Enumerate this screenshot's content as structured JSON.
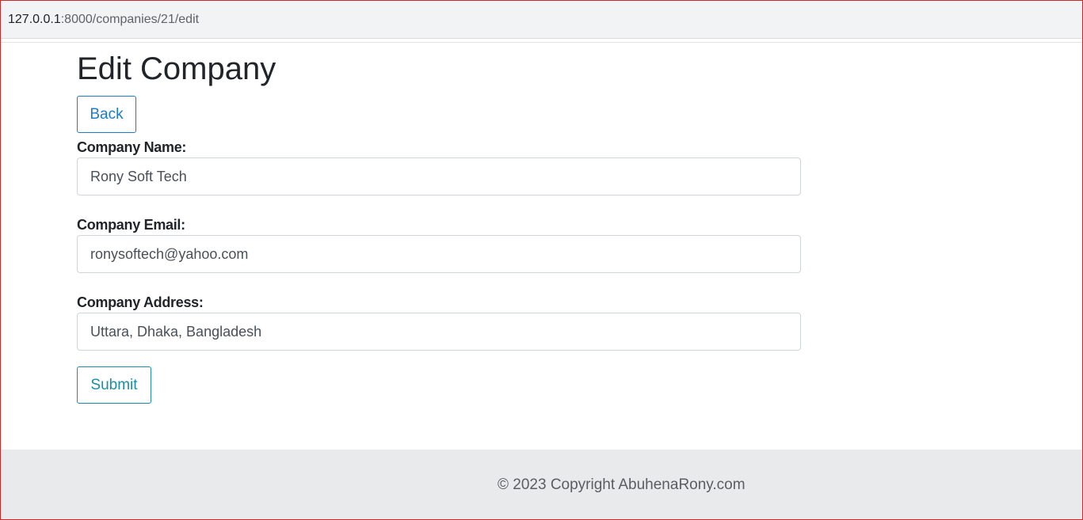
{
  "browser": {
    "url_host": "127.0.0.1",
    "url_path": ":8000/companies/21/edit"
  },
  "page": {
    "title": "Edit Company",
    "back_label": "Back"
  },
  "form": {
    "name_label": "Company Name:",
    "name_value": "Rony Soft Tech",
    "email_label": "Company Email:",
    "email_value": "ronysoftech@yahoo.com",
    "address_label": "Company Address:",
    "address_value": "Uttara, Dhaka, Bangladesh",
    "submit_label": "Submit"
  },
  "footer": {
    "text": "© 2023 Copyright AbuhenaRony.com"
  },
  "colors": {
    "back_button": "#1e7bcb",
    "submit_button": "#1b8ea3",
    "footer_bg": "#e9eaec"
  }
}
